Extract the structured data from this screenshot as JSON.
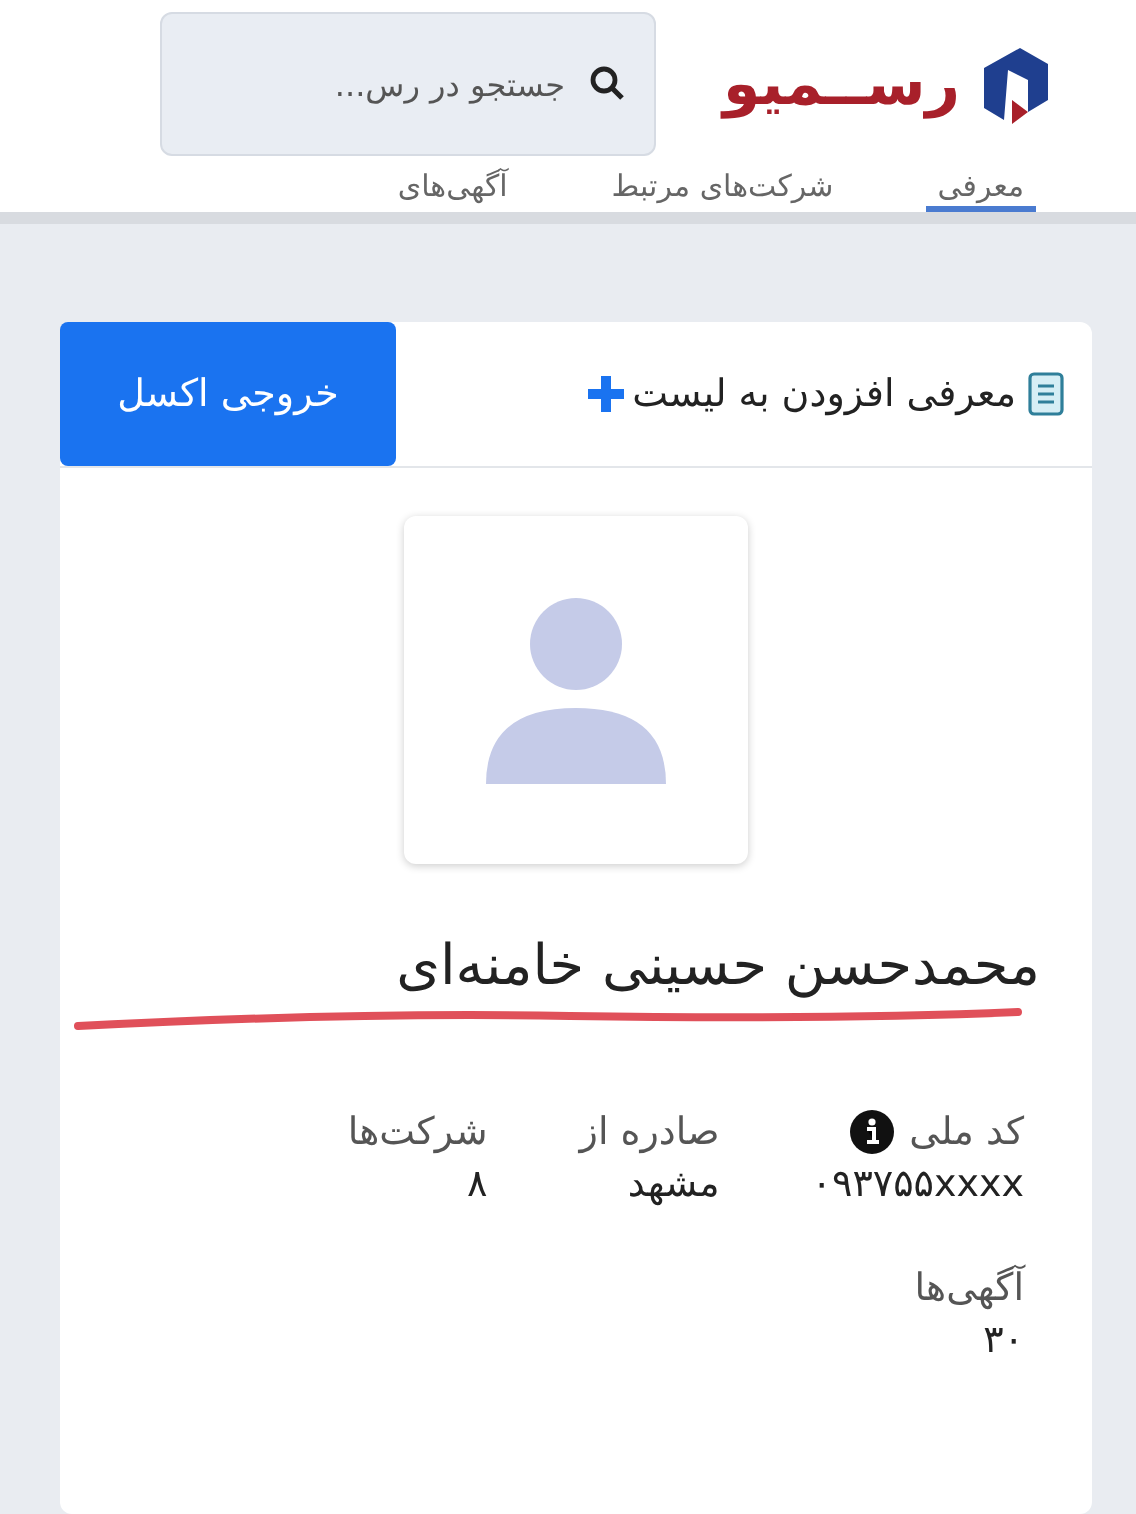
{
  "header": {
    "logo_text": "رســمیو",
    "search": {
      "placeholder": "جستجو در رس..."
    }
  },
  "tabs": [
    {
      "label": "معرفی",
      "selected": true
    },
    {
      "label": "شرکت‌های مرتبط",
      "selected": false
    },
    {
      "label": "آگهی‌های",
      "selected": false
    }
  ],
  "card": {
    "title": "معرفی",
    "add_to_list": "افزودن به لیست",
    "export_button": "خروجی اکسل",
    "name": "محمدحسن حسینی خامنه‌ای",
    "fields": [
      {
        "label": "کد ملی",
        "value": "۰۹۳۷۵۵xxxx",
        "info": true
      },
      {
        "label": "صادره از",
        "value": "مشهد"
      },
      {
        "label": "شرکت‌ها",
        "value": "۸"
      },
      {
        "label": "آگهی‌ها",
        "value": "۳۰"
      }
    ]
  }
}
